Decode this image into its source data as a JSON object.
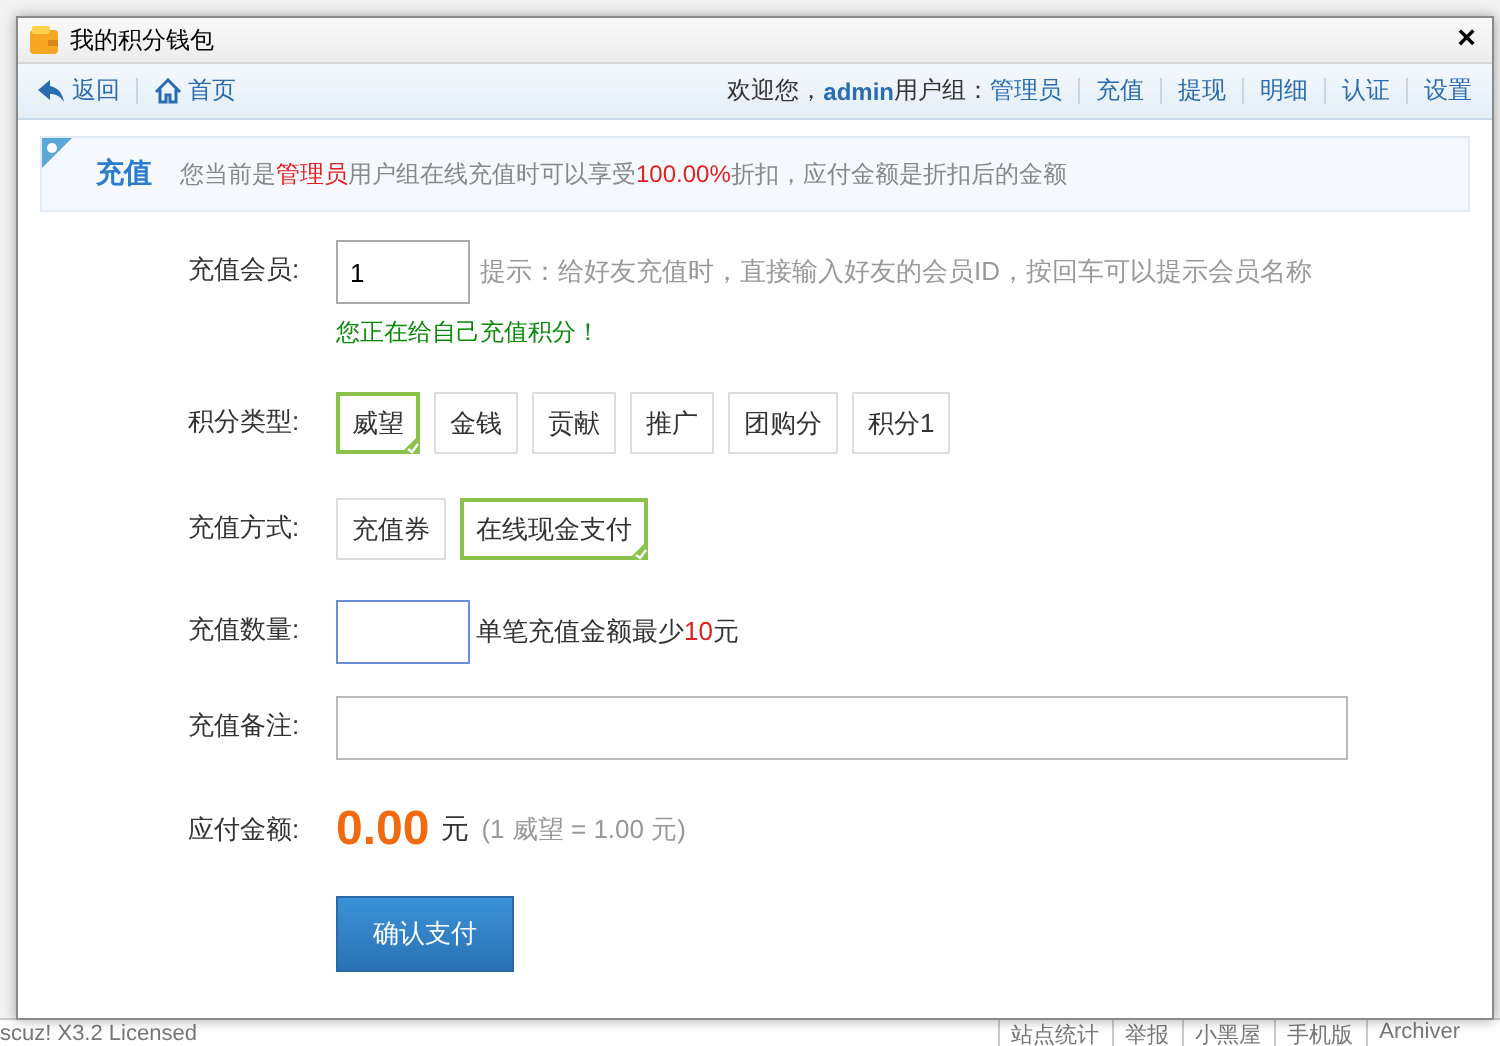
{
  "window": {
    "title": "我的积分钱包",
    "close": "×"
  },
  "toolbar": {
    "left": [
      {
        "kind": "back",
        "label": "返回"
      },
      {
        "kind": "home",
        "label": "首页"
      }
    ],
    "welcome": "欢迎您，",
    "user": "admin",
    "group_label": "用户组：",
    "group": "管理员",
    "links": [
      "充值",
      "提现",
      "明细",
      "认证",
      "设置"
    ]
  },
  "notice": {
    "title": "充值",
    "segments": [
      {
        "text": "您当前是",
        "highlight": false
      },
      {
        "text": "管理员",
        "highlight": true
      },
      {
        "text": "用户组在线充值时可以享受",
        "highlight": false
      },
      {
        "text": "100.00%",
        "highlight": true
      },
      {
        "text": "折扣，应付金额是折扣后的金额",
        "highlight": false
      }
    ]
  },
  "form": {
    "member": {
      "label": "充值会员:",
      "value": "1",
      "hint": "提示：给好友充值时，直接输入好友的会员ID，按回车可以提示会员名称",
      "status": "您正在给自己充值积分！"
    },
    "credit_type": {
      "label": "积分类型:",
      "options": [
        {
          "label": "威望",
          "selected": true
        },
        {
          "label": "金钱",
          "selected": false
        },
        {
          "label": "贡献",
          "selected": false
        },
        {
          "label": "推广",
          "selected": false
        },
        {
          "label": "团购分",
          "selected": false
        },
        {
          "label": "积分1",
          "selected": false
        }
      ]
    },
    "method": {
      "label": "充值方式:",
      "options": [
        {
          "label": "充值券",
          "selected": false
        },
        {
          "label": "在线现金支付",
          "selected": true
        }
      ]
    },
    "amount": {
      "label": "充值数量:",
      "focused": true,
      "note": [
        {
          "text": "单笔充值金额最少",
          "highlight": false
        },
        {
          "text": "10",
          "highlight": true
        },
        {
          "text": "元",
          "highlight": false
        }
      ]
    },
    "remark": {
      "label": "充值备注:",
      "focused": false
    },
    "payable": {
      "label": "应付金额:",
      "amount": "0.00",
      "unit": "元",
      "rate": "(1 威望 = 1.00 元)"
    },
    "submit": "确认支付"
  },
  "footer": {
    "license": "scuz! X3.2 Licensed",
    "links": [
      "站点统计",
      "举报",
      "小黑屋",
      "手机版",
      "Archiver"
    ]
  }
}
